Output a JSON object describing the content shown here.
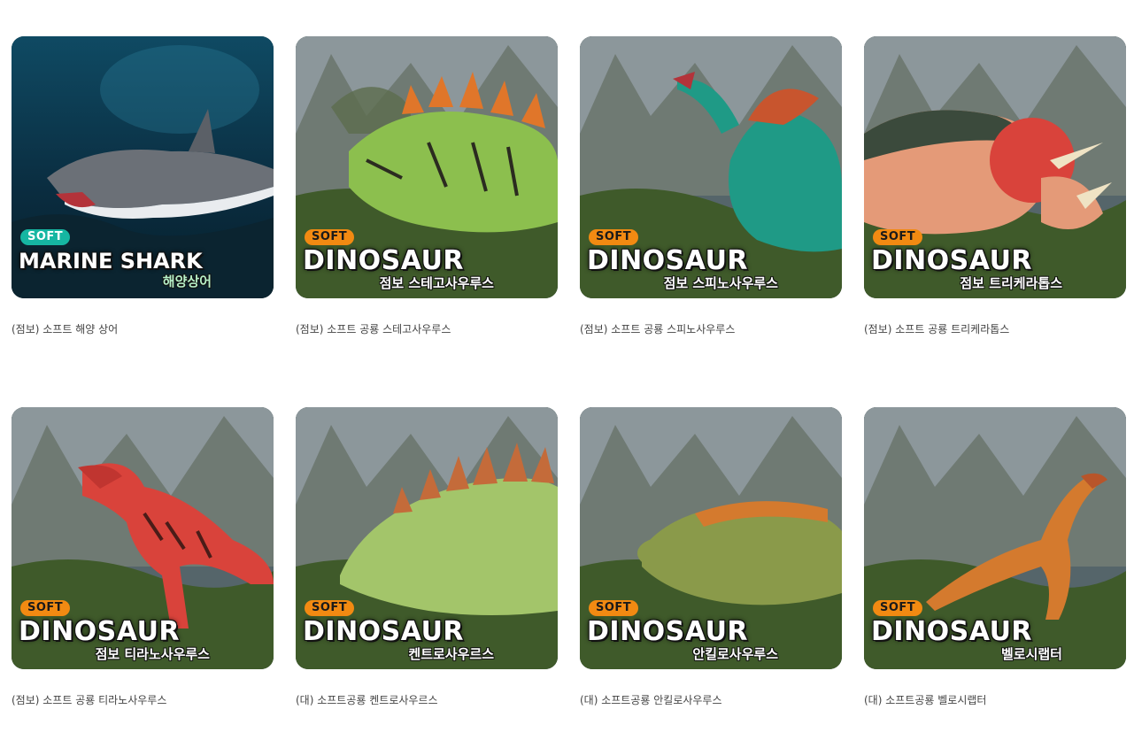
{
  "products": [
    {
      "badge": "SOFT",
      "headline": "MARINE SHARK",
      "subtitle": "해양상어",
      "caption": "(점보) 소프트 해양 상어",
      "kind": "shark",
      "badge_color": "#16b6a2",
      "body_color": "#6b7077"
    },
    {
      "badge": "SOFT",
      "headline": "DINOSAUR",
      "subtitle": "점보 스테고사우루스",
      "caption": "(점보) 소프트 공룡 스테고사우루스",
      "kind": "stego",
      "badge_color": "#f28a12",
      "body_color": "#8cbf4e"
    },
    {
      "badge": "SOFT",
      "headline": "DINOSAUR",
      "subtitle": "점보 스피노사우루스",
      "caption": "(점보) 소프트 공룡 스피노사우루스",
      "kind": "spino",
      "badge_color": "#f28a12",
      "body_color": "#1f9a86"
    },
    {
      "badge": "SOFT",
      "headline": "DINOSAUR",
      "subtitle": "점보 트리케라톱스",
      "caption": "(점보) 소프트 공룡 트리케라톱스",
      "kind": "trike",
      "badge_color": "#f28a12",
      "body_color": "#e49a78"
    },
    {
      "badge": "SOFT",
      "headline": "DINOSAUR",
      "subtitle": "점보 티라노사우루스",
      "caption": "(점보) 소프트 공룡 티라노사우루스",
      "kind": "trex",
      "badge_color": "#f28a12",
      "body_color": "#d9433b"
    },
    {
      "badge": "SOFT",
      "headline": "DINOSAUR",
      "subtitle": "켄트로사우르스",
      "caption": "(대) 소프트공룡 켄트로사우르스",
      "kind": "kentro",
      "badge_color": "#f28a12",
      "body_color": "#a3c56a"
    },
    {
      "badge": "SOFT",
      "headline": "DINOSAUR",
      "subtitle": "안킬로사우루스",
      "caption": "(대) 소프트공룡 안킬로사우루스",
      "kind": "ankylo",
      "badge_color": "#f28a12",
      "body_color": "#8a9a4a"
    },
    {
      "badge": "SOFT",
      "headline": "DINOSAUR",
      "subtitle": "벨로시랩터",
      "caption": "(대) 소프트공룡 벨로시랩터",
      "kind": "raptor",
      "badge_color": "#f28a12",
      "body_color": "#d47a2e"
    }
  ]
}
